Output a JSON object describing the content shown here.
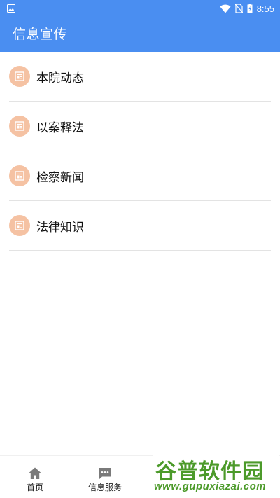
{
  "status_bar": {
    "time": "8:55",
    "icons": [
      "image-icon",
      "wifi-icon",
      "no-sim-icon",
      "battery-icon"
    ]
  },
  "app_bar": {
    "title": "信息宣传"
  },
  "list": {
    "items": [
      {
        "label": "本院动态",
        "icon": "news-icon"
      },
      {
        "label": "以案释法",
        "icon": "news-icon"
      },
      {
        "label": "检察新闻",
        "icon": "news-icon"
      },
      {
        "label": "法律知识",
        "icon": "news-icon"
      }
    ]
  },
  "bottom_nav": {
    "tabs": [
      {
        "label": "首页",
        "icon": "home-icon"
      },
      {
        "label": "信息服务",
        "icon": "chat-icon"
      }
    ]
  },
  "watermark": {
    "main": "谷普软件园",
    "sub": "www.gupuxiazai.com"
  },
  "colors": {
    "primary": "#4a8ef1",
    "icon_bg": "#f5c2a3",
    "icon_fg": "#ffffff",
    "watermark": "#4c9a2a",
    "nav_icon": "#7a7a7a"
  }
}
